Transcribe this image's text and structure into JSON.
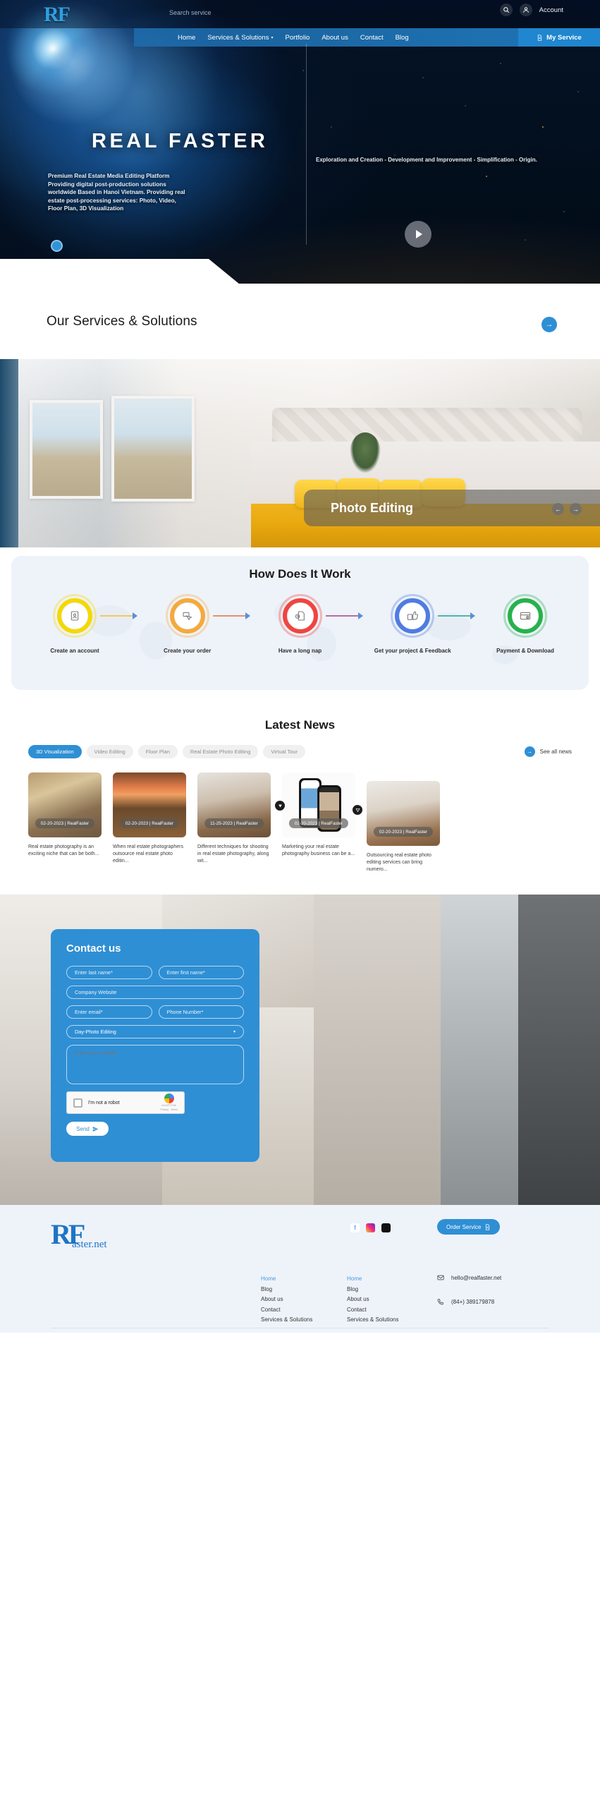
{
  "header": {
    "logo_text": "RF",
    "search_placeholder": "Search service",
    "search_value": "",
    "search_icon": "search-icon",
    "account_icon": "user-icon",
    "account_label": "Account",
    "nav": [
      {
        "label": "Home",
        "has_caret": false
      },
      {
        "label": "Services & Solutions",
        "has_caret": true
      },
      {
        "label": "Portfolio",
        "has_caret": false
      },
      {
        "label": "About us",
        "has_caret": false
      },
      {
        "label": "Contact",
        "has_caret": false
      },
      {
        "label": "Blog",
        "has_caret": false
      }
    ],
    "my_service_label": "My Service"
  },
  "hero": {
    "title": "REAL FASTER",
    "subtitle": "Premium Real Estate Media Editing Platform Providing digital post-production solutions worldwide Based in Hanoi Vietnam. Providing real estate post-processing services: Photo, Video, Floor Plan, 3D Visualization",
    "tagline": "Exploration and Creation - Development and Improvement - Simplification - Origin.",
    "play_icon": "play-icon",
    "dot_icon": "slider-dot-icon"
  },
  "services": {
    "title": "Our Services & Solutions",
    "arrow_icon": "arrow-right-icon",
    "slide_title": "Photo Editing",
    "prev_icon": "arrow-left-icon",
    "next_icon": "arrow-right-icon"
  },
  "how": {
    "title": "How Does It Work",
    "steps": [
      {
        "label": "Create an account",
        "color": "#f5d800",
        "icon": "id-card-icon"
      },
      {
        "label": "Create your order",
        "color": "#f6a93b",
        "icon": "order-click-icon"
      },
      {
        "label": "Have a long nap",
        "color": "#f0453f",
        "icon": "document-clock-icon"
      },
      {
        "label": "Get your project & Feedback",
        "color": "#4f7ce0",
        "icon": "thumbs-up-document-icon"
      },
      {
        "label": "Payment & Download",
        "color": "#26b24b",
        "icon": "credit-card-icon"
      }
    ]
  },
  "news": {
    "title": "Latest News",
    "tabs": [
      {
        "label": "3D Visualization",
        "active": true
      },
      {
        "label": "Video Editing",
        "active": false
      },
      {
        "label": "Floor Plan",
        "active": false
      },
      {
        "label": "Real Estate Photo Editing",
        "active": false
      },
      {
        "label": "Virtual Tour",
        "active": false
      }
    ],
    "see_all_label": "See all news",
    "see_all_icon": "arrow-right-icon",
    "prev_icon": "carousel-prev-icon",
    "next_icon": "carousel-next-icon",
    "cards": [
      {
        "badge": "02-20-2023 | RealFaster",
        "text": "Real estate photography is an exciting niche that can be both..."
      },
      {
        "badge": "02-20-2023 | RealFaster",
        "text": "When real estate photographers outsource real estate photo editin..."
      },
      {
        "badge": "11-25-2023 | RealFaster",
        "text": "Different techniques for shooting in real estate photography, along wit..."
      },
      {
        "badge": "02-20-2023 | RealFaster",
        "text": "Marketing your real estate photography business can be a..."
      },
      {
        "badge": "02-20-2023 | RealFaster",
        "text": "Outsourcing real estate photo editing services can bring numero..."
      }
    ]
  },
  "contact": {
    "title": "Contact us",
    "last_name_placeholder": "Enter last name*",
    "first_name_placeholder": "Enter first name*",
    "company_placeholder": "Company Website",
    "email_placeholder": "Enter email*",
    "phone_placeholder": "Phone Number*",
    "service_selected": "Day-Photo Editing",
    "content_placeholder": "Enter your content",
    "recaptcha_label": "I'm not a robot",
    "recaptcha_brand": "reCAPTCHA",
    "recaptcha_terms": "Privacy - Terms",
    "send_label": "Send",
    "send_icon": "send-icon",
    "dropdown_icon": "chevron-down-icon"
  },
  "footer": {
    "logo_main": "RF",
    "logo_sub": "aster.net",
    "socials": [
      {
        "name": "facebook-icon",
        "glyph": "f"
      },
      {
        "name": "instagram-icon",
        "glyph": "▢"
      },
      {
        "name": "tiktok-icon",
        "glyph": "♪"
      }
    ],
    "order_label": "Order Service",
    "order_icon": "document-icon",
    "col1": [
      "Home",
      "Blog",
      "About us",
      "Contact",
      "Services & Solutions"
    ],
    "col2": [
      "Home",
      "Blog",
      "About us",
      "Contact",
      "Services & Solutions"
    ],
    "email": "hello@realfaster.net",
    "email_icon": "mail-icon",
    "phone": "(84+) 389179878",
    "phone_icon": "phone-icon"
  },
  "colors": {
    "accent": "#2f8fd4",
    "footer_bg": "#eef3fa",
    "how_bg": "#eef3fa"
  }
}
